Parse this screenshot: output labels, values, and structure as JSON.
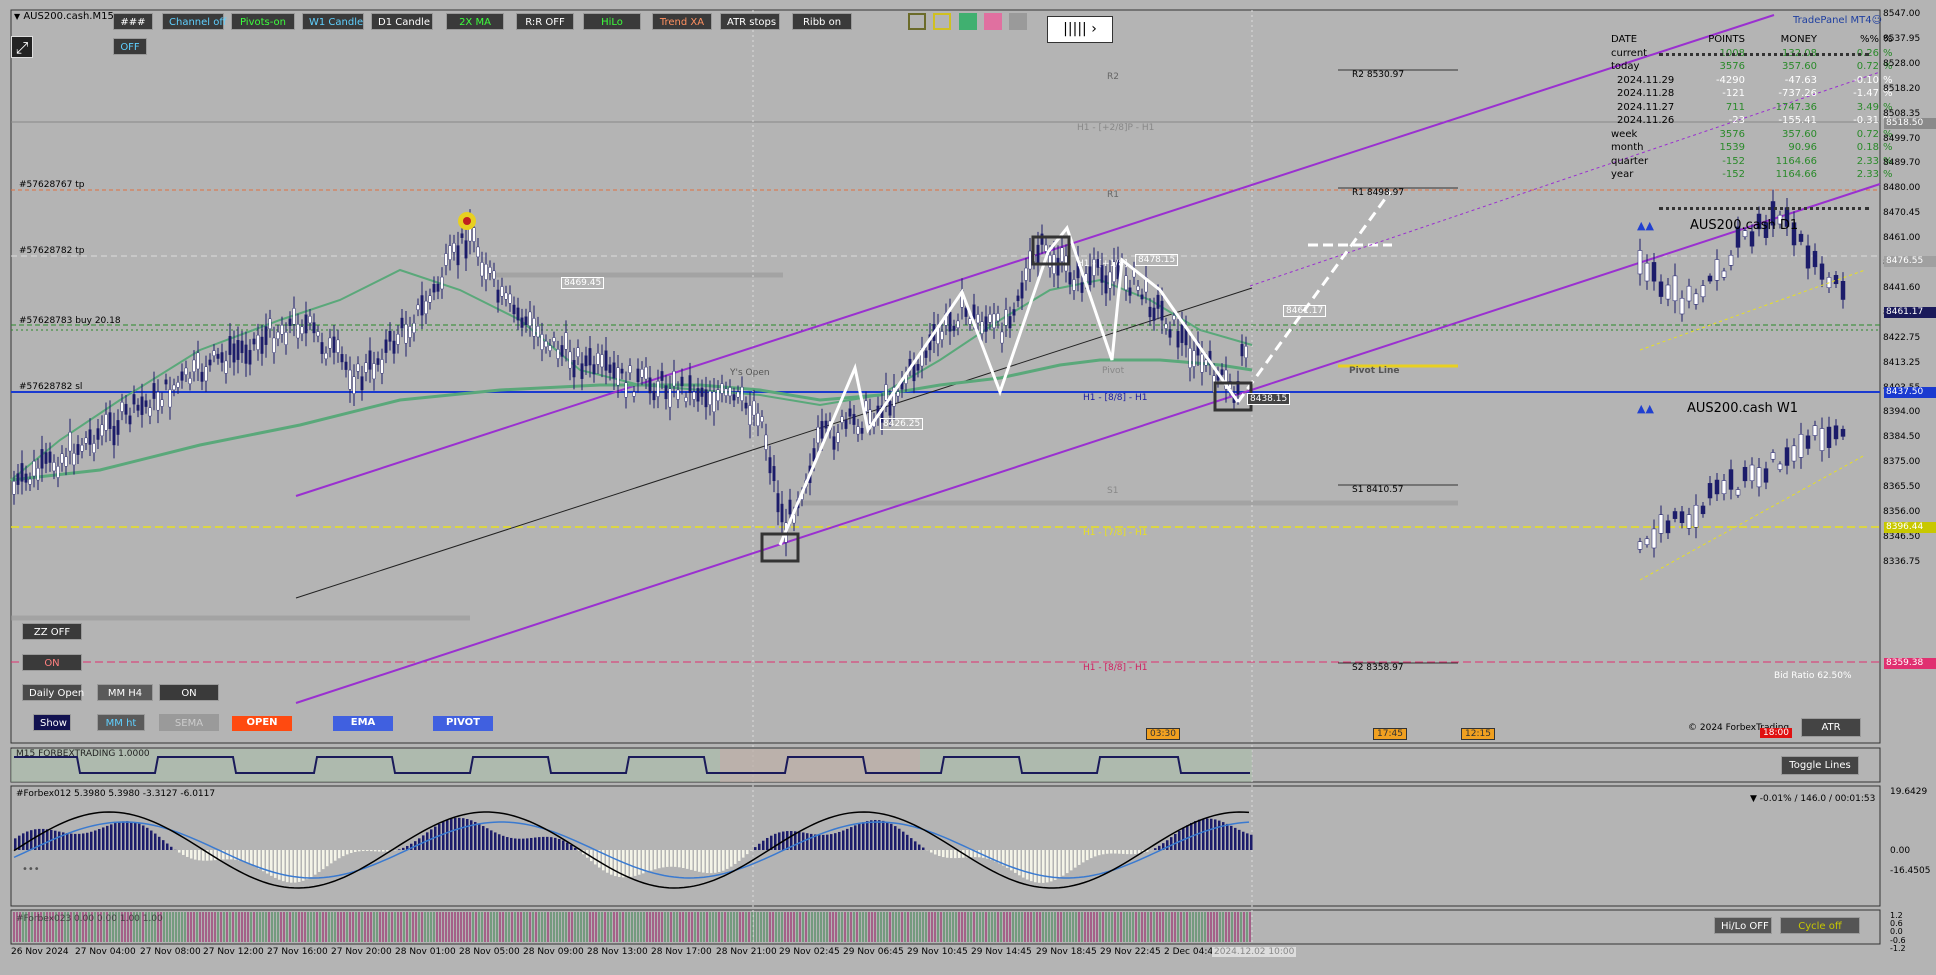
{
  "chart": {
    "title": "AUS200.cash.M15"
  },
  "toolbar_buttons": [
    {
      "label": "###",
      "color": "#ffffff"
    },
    {
      "label": "Channel off",
      "color": "#5fd0ff"
    },
    {
      "label": "Pivots-on",
      "color": "#3cff3c"
    },
    {
      "label": "W1 Candle",
      "color": "#5fd0ff"
    },
    {
      "label": "D1 Candle",
      "color": "#ffffff"
    },
    {
      "label": "2X MA",
      "color": "#3cff3c"
    },
    {
      "label": "R:R OFF",
      "color": "#ffffff"
    },
    {
      "label": "HiLo",
      "color": "#3cff3c"
    },
    {
      "label": "Trend XA",
      "color": "#ff9060"
    },
    {
      "label": "ATR stops",
      "color": "#ffffff"
    },
    {
      "label": "Ribb on",
      "color": "#ffffff"
    }
  ],
  "off_button": "OFF",
  "expand_glyph": "⤢",
  "left_panel": {
    "zz_off": "ZZ OFF",
    "on1": "ON",
    "daily_open": "Daily Open",
    "mm_h4": "MM H4",
    "on2": "ON",
    "show": "Show",
    "mm_ht": "MM ht",
    "sema": "SEMA",
    "open": "OPEN",
    "ema": "EMA",
    "pivot": "PIVOT"
  },
  "trade_labels": {
    "tp1": "#57628767 tp",
    "tp2": "#57628782 tp",
    "buy": "#57628783 buy 20.18",
    "sl": "#57628782 sl"
  },
  "levels": {
    "r2": "R2",
    "r2_line": "R2 8530.97",
    "h1_top": "H1 - [+2/8]P - H1",
    "r1": "R1",
    "r1_line": "R1 8498.97",
    "h1_mid": "H1 - [+1/8]",
    "pivot": "Pivot",
    "pivot_line": "Pivot Line",
    "ys_open": "Y's Open",
    "h1_88": "H1 - [8/8] - H1",
    "s1": "S1",
    "s1_line": "S1 8410.57",
    "h1_78": "H1 - [7/8] - H1",
    "h1_bottom": "H1 - [8/8] - H1",
    "s2_line": "S2 8358.97"
  },
  "price_tags": {
    "p1": "8469.45",
    "p2": "8426.25",
    "p3": "8478.15",
    "p4": "8461.17",
    "p5": "8438.15"
  },
  "trade_panel": {
    "brand": "TradePanel MT4☺",
    "headers": [
      "DATE",
      "POINTS",
      "MONEY",
      "%%",
      "%"
    ],
    "rows": [
      {
        "d": "current",
        "p": "1008",
        "m": "132.08",
        "pc": "0.26",
        "u": "%",
        "pos": true
      },
      {
        "d": "today",
        "p": "3576",
        "m": "357.60",
        "pc": "0.72",
        "u": "%",
        "pos": true
      },
      {
        "d": "2024.11.29",
        "p": "-4290",
        "m": "-47.63",
        "pc": "-0.10",
        "u": "%",
        "pos": false
      },
      {
        "d": "2024.11.28",
        "p": "-121",
        "m": "-737.26",
        "pc": "-1.47",
        "u": "%",
        "pos": false
      },
      {
        "d": "2024.11.27",
        "p": "711",
        "m": "1747.36",
        "pc": "3.49",
        "u": "%",
        "pos": true
      },
      {
        "d": "2024.11.26",
        "p": "-23",
        "m": "-155.41",
        "pc": "-0.31",
        "u": "%",
        "pos": false
      },
      {
        "d": "week",
        "p": "3576",
        "m": "357.60",
        "pc": "0.72",
        "u": "%",
        "pos": true
      },
      {
        "d": "month",
        "p": "1539",
        "m": "90.96",
        "pc": "0.18",
        "u": "%",
        "pos": true
      },
      {
        "d": "quarter",
        "p": "-152",
        "m": "1164.66",
        "pc": "2.33",
        "u": "%",
        "pos": true
      },
      {
        "d": "year",
        "p": "-152",
        "m": "1164.66",
        "pc": "2.33",
        "u": "%",
        "pos": true
      }
    ]
  },
  "mini_charts": {
    "d1": "AUS200.cash D1",
    "w1": "AUS200.cash W1",
    "arrows": "▲▲"
  },
  "bid_ratio": "Bid Ratio 62.50%",
  "copyright": "© 2024 ForbexTrading",
  "atr": "ATR",
  "time_tags": {
    "t1": "03:30",
    "t2": "17:45",
    "t3": "12:15",
    "t4": "18:00"
  },
  "indicators": {
    "ind1": "M15 FORBEXTRADING 1.0000",
    "toggle": "Toggle Lines",
    "ind2": "#Forbex012 5.3980 5.3980 -3.3127 -6.0117",
    "ind2_right": "▼ -0.01% / 146.0 / 00:01:53",
    "ind3": "#Forbex023 0.00 0.00 1.00 1.00",
    "hilo_off": "Hi/Lo OFF",
    "cycle_off": "Cycle off",
    "dots": "•••"
  },
  "price_axis": [
    "8547.00",
    "8537.95",
    "8528.00",
    "8518.20",
    "8508.35",
    "8499.70",
    "8489.70",
    "8480.00",
    "8470.45",
    "8461.00",
    "8451.35",
    "8441.60",
    "8432.35",
    "8422.75",
    "8413.25",
    "8403.55",
    "8394.00",
    "8384.50",
    "8375.00",
    "8365.50",
    "8356.00",
    "8346.50",
    "8336.75"
  ],
  "price_tag_axis": [
    {
      "v": "8518.50",
      "c": "#8a8a8a"
    },
    {
      "v": "8476.55",
      "c": "#a0a0a0"
    },
    {
      "v": "8461.17",
      "c": "#1a1a5a"
    },
    {
      "v": "8437.50",
      "c": "#1a3ad0"
    },
    {
      "v": "8396.44",
      "c": "#c8c800"
    },
    {
      "v": "8359.38",
      "c": "#e03070"
    }
  ],
  "ind_axis": [
    "19.6429",
    "0.00",
    "-16.4505"
  ],
  "ind3_axis": [
    "1.2",
    "0.6",
    "0.0",
    "-0.6",
    "-1.2"
  ],
  "time_axis": [
    "26 Nov 2024",
    "27 Nov 04:00",
    "27 Nov 08:00",
    "27 Nov 12:00",
    "27 Nov 16:00",
    "27 Nov 20:00",
    "28 Nov 01:00",
    "28 Nov 05:00",
    "28 Nov 09:00",
    "28 Nov 13:00",
    "28 Nov 17:00",
    "28 Nov 21:00",
    "29 Nov 02:45",
    "29 Nov 06:45",
    "29 Nov 10:45",
    "29 Nov 14:45",
    "29 Nov 18:45",
    "29 Nov 22:45",
    "2 Dec 04:4",
    "2024.12.02 10:00"
  ],
  "colors": {
    "bg": "#b4b4b4",
    "bull": "#1c1c6a",
    "bear": "#ffffff",
    "channel": "#9a30d0",
    "ma": "#5aa87a"
  }
}
